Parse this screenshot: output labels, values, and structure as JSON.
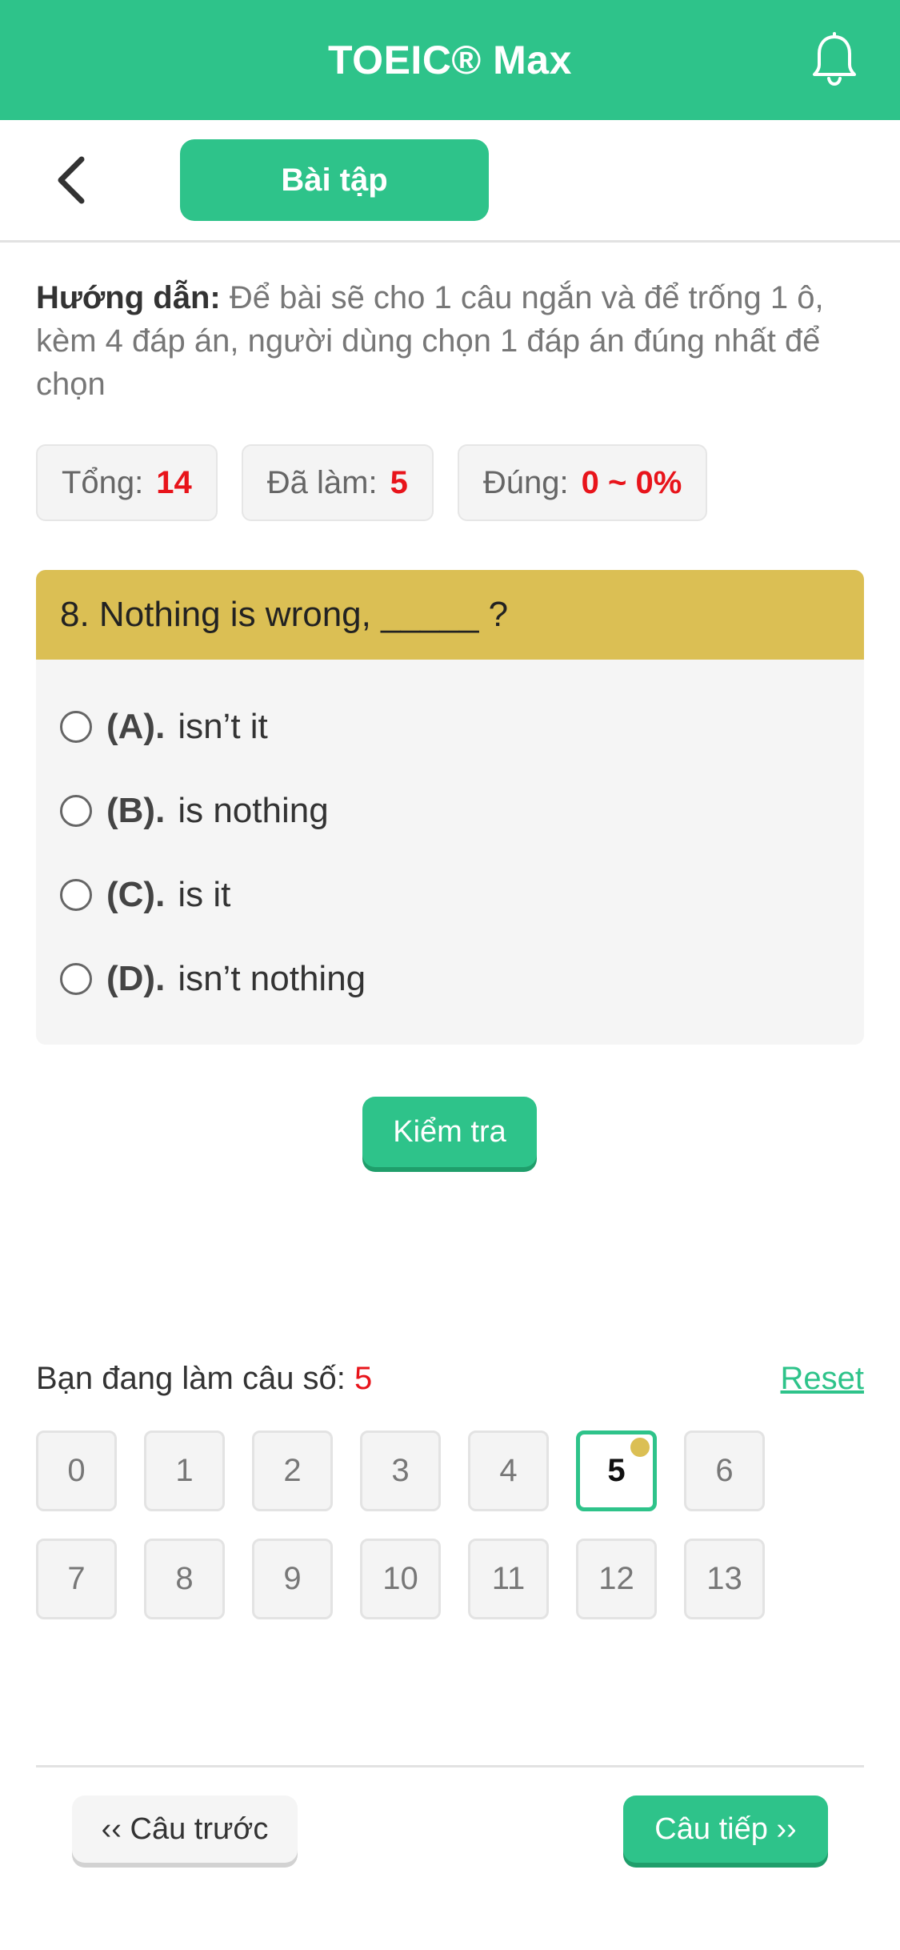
{
  "header": {
    "title": "TOEIC® Max",
    "bell_icon": "bell-icon"
  },
  "subbar": {
    "back_icon": "chevron-left-icon",
    "tab_label": "Bài tập"
  },
  "guide": {
    "label": "Hướng dẫn:",
    "text": "Để bài sẽ cho 1 câu ngắn và để trống 1 ô, kèm 4 đáp án, người dùng chọn 1 đáp án đúng nhất để chọn"
  },
  "stats": {
    "total_label": "Tổng:",
    "total_value": "14",
    "done_label": "Đã làm:",
    "done_value": "5",
    "correct_label": "Đúng:",
    "correct_value": "0 ~ 0%"
  },
  "question": {
    "title": "8. Nothing is wrong, _____ ?",
    "options": [
      {
        "key": "(A).",
        "text": "isn’t it"
      },
      {
        "key": "(B).",
        "text": "is nothing"
      },
      {
        "key": "(C).",
        "text": "is it"
      },
      {
        "key": "(D).",
        "text": "isn’t nothing"
      }
    ]
  },
  "check_label": "Kiểm tra",
  "progress": {
    "current_label": "Bạn đang làm câu số:",
    "current_value": "5",
    "reset_label": "Reset",
    "numbers": [
      "0",
      "1",
      "2",
      "3",
      "4",
      "5",
      "6",
      "7",
      "8",
      "9",
      "10",
      "11",
      "12",
      "13"
    ],
    "active": "5"
  },
  "nav": {
    "prev_label": "‹‹ Câu trước",
    "next_label": "Câu tiếp ››"
  },
  "colors": {
    "brand": "#2ec38a",
    "accent_gold": "#dbbf54",
    "highlight_red": "#e8141b"
  }
}
